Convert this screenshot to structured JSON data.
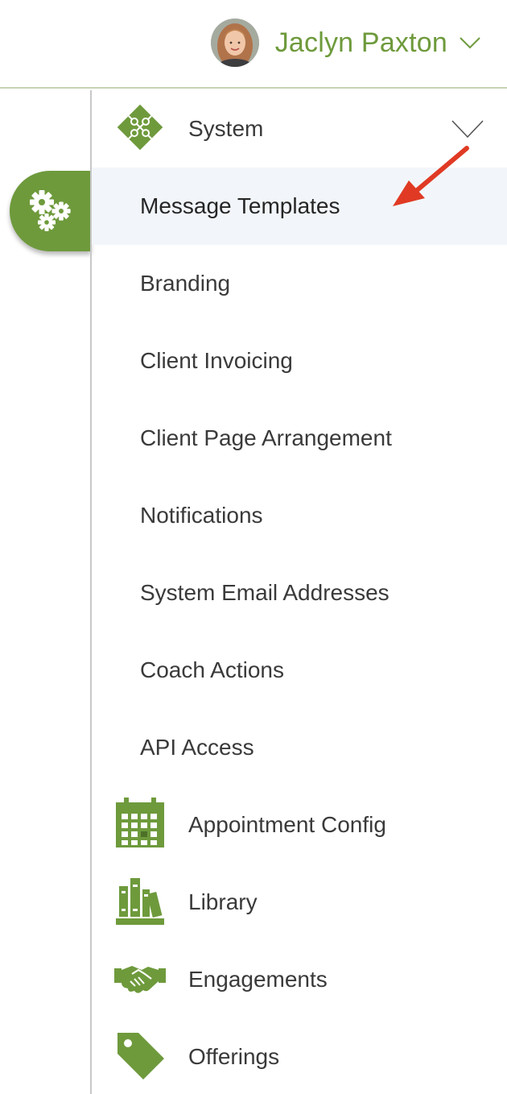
{
  "colors": {
    "brand_green": "#6e9a3c",
    "active_row_bg": "#f2f6fa",
    "header_border": "#c7d3b2",
    "annotation_arrow": "#e03a24"
  },
  "header": {
    "user": {
      "name": "Jaclyn Paxton",
      "avatar_icon": "user-photo-avatar",
      "menu_icon": "chevron-down-icon"
    }
  },
  "rail": {
    "active_icon": "gears-icon"
  },
  "menu": {
    "system": {
      "label": "System",
      "icon": "puzzle-icon",
      "expanded": true,
      "items": [
        {
          "label": "Message Templates",
          "active": true
        },
        {
          "label": "Branding"
        },
        {
          "label": "Client Invoicing"
        },
        {
          "label": "Client Page Arrangement"
        },
        {
          "label": "Notifications"
        },
        {
          "label": "System Email Addresses"
        },
        {
          "label": "Coach Actions"
        },
        {
          "label": "API Access"
        }
      ]
    },
    "sections": [
      {
        "label": "Appointment Config",
        "icon": "calendar-icon"
      },
      {
        "label": "Library",
        "icon": "books-icon"
      },
      {
        "label": "Engagements",
        "icon": "handshake-icon"
      },
      {
        "label": "Offerings",
        "icon": "tag-icon"
      }
    ]
  }
}
